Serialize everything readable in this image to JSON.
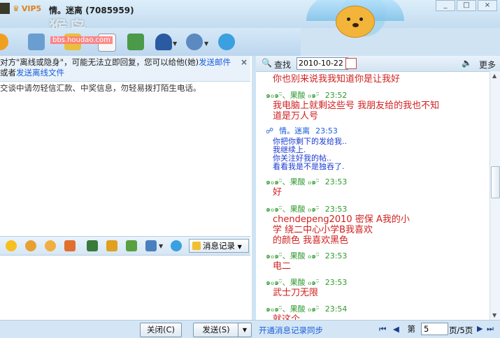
{
  "window": {
    "vip_label": "VIP5",
    "title": "情。迷离 (7085959)",
    "minimize": "_",
    "maximize": "□",
    "close": "×"
  },
  "watermark": {
    "big": "猴岛",
    "small": "bbs.houdao.com"
  },
  "notice": {
    "text_1": "对方\"离线或隐身\"，可能无法立即回复，您可以给他(她)",
    "link_1": "发送邮件",
    "text_2": "或者",
    "link_2": "发送离线文件",
    "close": "×"
  },
  "warning": "交谈中请勿轻信汇款、中奖信息，勿轻易拨打陌生电话。",
  "input_toolbar": {
    "message_record": "消息记录"
  },
  "buttons": {
    "close": "关闭(C)",
    "send": "发送(S)"
  },
  "history_toolbar": {
    "find": "查找",
    "date": "2010-10-22",
    "more": "更多"
  },
  "messages": [
    {
      "kind": "text-red",
      "text": "你也别来说我我知道你是让我好"
    },
    {
      "kind": "header",
      "sender": "๑ℴ๑ᵕ̈、果酸 ℴ๑ᵕ̈",
      "time": "23:52"
    },
    {
      "kind": "text-red",
      "text": "我电脑上就剩这些号  我朋友给的我也不知"
    },
    {
      "kind": "text-red",
      "text": "道是万人号"
    },
    {
      "kind": "header-self",
      "sender": "情。迷离",
      "time": "23:53"
    },
    {
      "kind": "text-blue",
      "text": "你把你剩下的发给我.."
    },
    {
      "kind": "text-blue",
      "text": "我继续上."
    },
    {
      "kind": "text-blue",
      "text": "你关注好我的帖.."
    },
    {
      "kind": "text-blue",
      "text": "看看我是不是独吞了."
    },
    {
      "kind": "header",
      "sender": "๑ℴ๑ᵕ̈、果酸 ℴ๑ᵕ̈",
      "time": "23:53"
    },
    {
      "kind": "text-red",
      "text": "好"
    },
    {
      "kind": "header",
      "sender": "๑ℴ๑ᵕ̈、果酸 ℴ๑ᵕ̈",
      "time": "23:53"
    },
    {
      "kind": "text-red",
      "text": "chendepeng2010    密保  A我的小"
    },
    {
      "kind": "text-red",
      "text": "学                        绕二中心小学B我喜欢"
    },
    {
      "kind": "text-red",
      "text": "的颜色  我喜欢黑色"
    },
    {
      "kind": "header",
      "sender": "๑ℴ๑ᵕ̈、果酸 ℴ๑ᵕ̈",
      "time": "23:53"
    },
    {
      "kind": "text-red",
      "text": "电二"
    },
    {
      "kind": "header",
      "sender": "๑ℴ๑ᵕ̈、果酸 ℴ๑ᵕ̈",
      "time": "23:53"
    },
    {
      "kind": "text-red",
      "text": "武士刀无限"
    },
    {
      "kind": "header",
      "sender": "๑ℴ๑ᵕ̈、果酸 ℴ๑ᵕ̈",
      "time": "23:54"
    },
    {
      "kind": "text-red",
      "text": "就这个"
    }
  ],
  "bottom_right": {
    "sync_link": "开通消息记录同步",
    "page_label": "第",
    "page_value": "5",
    "page_total": "页/5页"
  },
  "colors": {
    "accent": "#1a5ed8",
    "red_text": "#d02020",
    "green_header": "#2f9a2f"
  },
  "icons": {
    "toolbar": [
      "video-icon",
      "voice-icon",
      "file-transfer-icon",
      "mail-icon",
      "add-contact-icon",
      "app-center-icon",
      "settings-icon",
      "skype-icon"
    ],
    "input_toolbar": [
      "emoticon-icon",
      "magic-face-icon",
      "wink-icon",
      "scissors-icon",
      "image-icon",
      "music-icon",
      "gift-icon",
      "screenshot-icon",
      "skype-icon"
    ]
  }
}
